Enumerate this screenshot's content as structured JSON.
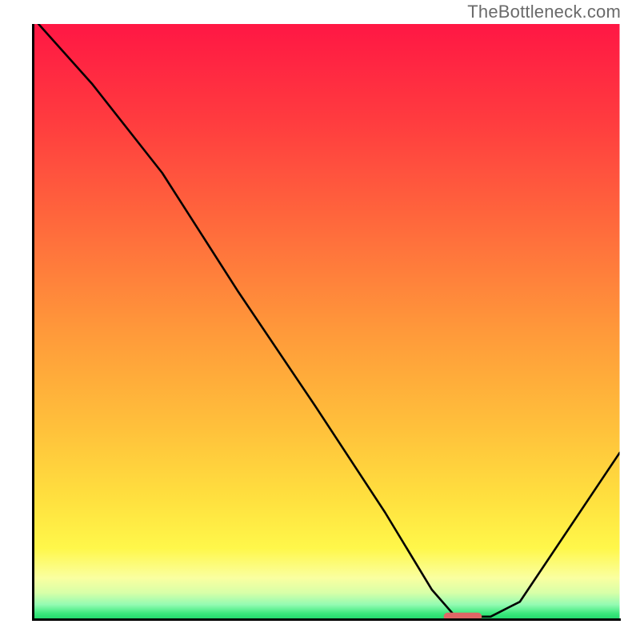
{
  "watermark": "TheBottleneck.com",
  "chart_data": {
    "type": "line",
    "title": "",
    "xlabel": "",
    "ylabel": "",
    "xlim": [
      0,
      100
    ],
    "ylim": [
      0,
      100
    ],
    "x": [
      0,
      10,
      22,
      35,
      48,
      60,
      68,
      72,
      78,
      83,
      100
    ],
    "values": [
      101,
      90,
      75,
      55,
      36,
      18,
      5,
      0.5,
      0.5,
      3,
      28
    ],
    "marker": {
      "x_start": 70,
      "x_end": 76.5,
      "y": 0.5,
      "color": "#e06666"
    },
    "gradient_stops": [
      {
        "offset": 0.0,
        "color": "#ff1744"
      },
      {
        "offset": 0.16,
        "color": "#ff3b3f"
      },
      {
        "offset": 0.34,
        "color": "#ff6a3c"
      },
      {
        "offset": 0.52,
        "color": "#ff9a3a"
      },
      {
        "offset": 0.68,
        "color": "#ffc13b"
      },
      {
        "offset": 0.8,
        "color": "#ffe13f"
      },
      {
        "offset": 0.88,
        "color": "#fff74a"
      },
      {
        "offset": 0.93,
        "color": "#faffa0"
      },
      {
        "offset": 0.955,
        "color": "#d8ffa8"
      },
      {
        "offset": 0.975,
        "color": "#93fbb2"
      },
      {
        "offset": 0.99,
        "color": "#3ae87c"
      },
      {
        "offset": 1.0,
        "color": "#1fd66a"
      }
    ],
    "axis_color": "#000000",
    "line_color": "#000000",
    "legend": null,
    "grid": false
  }
}
